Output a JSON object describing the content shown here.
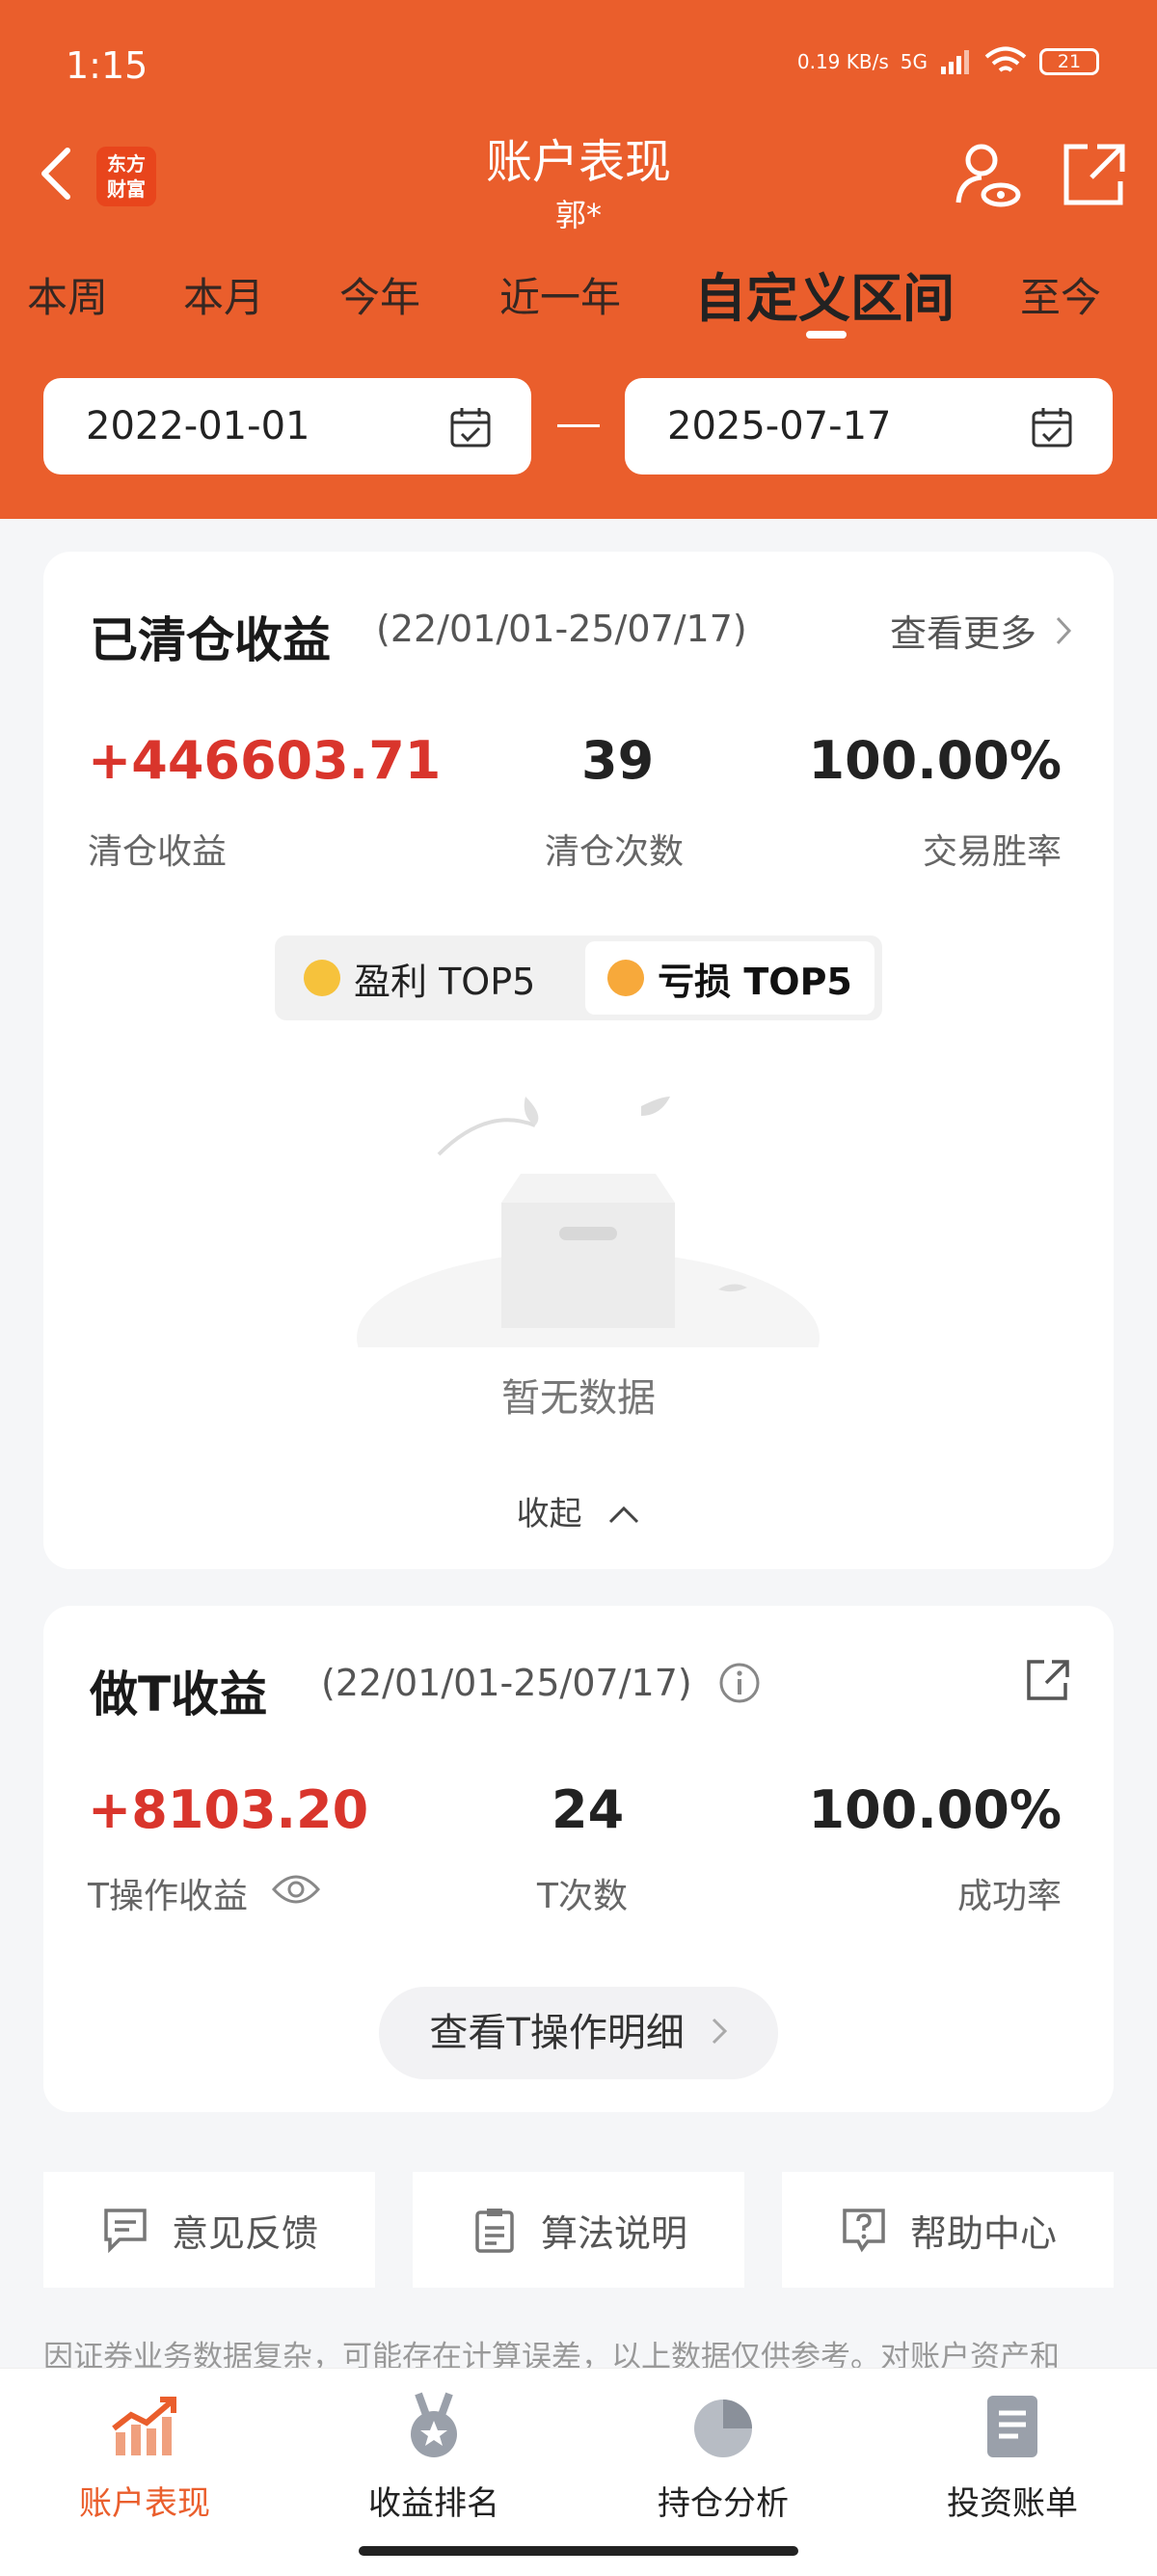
{
  "status": {
    "time": "1:15",
    "speed": "0.19 KB/s",
    "network": "5G",
    "battery": "21"
  },
  "header": {
    "brand_line1": "东方",
    "brand_line2": "财富",
    "title": "账户表现",
    "subtitle": "郭*"
  },
  "tabs": [
    "本周",
    "本月",
    "今年",
    "近一年",
    "自定义区间",
    "至今"
  ],
  "active_tab": "自定义区间",
  "date_range": {
    "start": "2022-01-01",
    "end": "2025-07-17",
    "separator": "—"
  },
  "cleared": {
    "title": "已清仓收益",
    "range": "(22/01/01-25/07/17)",
    "more": "查看更多",
    "stats": [
      {
        "value": "+446603.71",
        "label": "清仓收益"
      },
      {
        "value": "39",
        "label": "清仓次数"
      },
      {
        "value": "100.00%",
        "label": "交易胜率"
      }
    ],
    "toggle": {
      "profit": "盈利 TOP5",
      "loss": "亏损 TOP5",
      "active": "亏损 TOP5"
    },
    "empty": "暂无数据",
    "collapse": "收起"
  },
  "t_trade": {
    "title": "做T收益",
    "range": "(22/01/01-25/07/17)",
    "stats": [
      {
        "value": "+8103.20",
        "label": "T操作收益"
      },
      {
        "value": "24",
        "label": "T次数"
      },
      {
        "value": "100.00%",
        "label": "成功率"
      }
    ],
    "detail_button": "查看T操作明细"
  },
  "footer_buttons": [
    "意见反馈",
    "算法说明",
    "帮助中心"
  ],
  "disclaimer": "因证券业务数据复杂，可能存在计算误差，以上数据仅供参考。对账户资产和",
  "tabbar": [
    {
      "label": "账户表现",
      "icon": "chart-up-icon"
    },
    {
      "label": "收益排名",
      "icon": "medal-icon"
    },
    {
      "label": "持仓分析",
      "icon": "pie-chart-icon"
    },
    {
      "label": "投资账单",
      "icon": "bill-icon"
    }
  ],
  "colors": {
    "brand": "#ea5e2c",
    "profit_red": "#d9352c"
  }
}
